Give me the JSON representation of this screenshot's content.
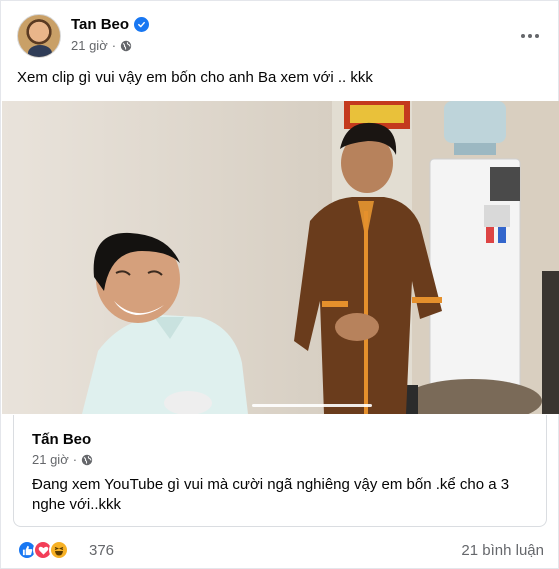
{
  "post": {
    "author": "Tan Beo",
    "time": "21 giờ",
    "text": "Xem clip gì vui vậy em bốn cho anh Ba xem với .. kkk",
    "more_icon": "more-horizontal-icon",
    "privacy_icon": "globe-icon",
    "verified_icon": "verified-badge-icon"
  },
  "shared": {
    "author": "Tấn Beo",
    "time": "21 giờ",
    "text": "Đang xem YouTube gì vui mà cười ngã nghiêng vậy em bốn .kể cho a 3 nghe với..kkk"
  },
  "footer": {
    "reaction_icons": [
      "like-icon",
      "love-icon",
      "haha-icon"
    ],
    "reaction_count": "376",
    "comments": "21 bình luận"
  },
  "colors": {
    "accent": "#1877f2",
    "secondary_text": "#65676b",
    "love": "#f33e58",
    "haha": "#f7b125"
  }
}
